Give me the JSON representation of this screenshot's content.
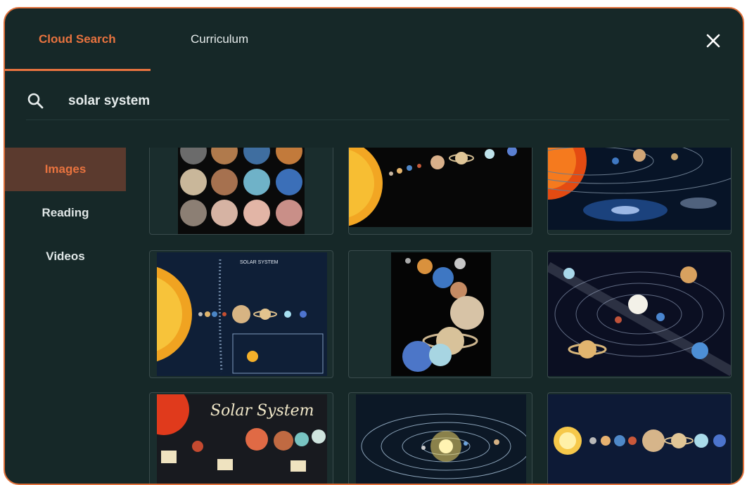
{
  "tabs": [
    {
      "label": "Cloud Search",
      "active": true
    },
    {
      "label": "Curriculum",
      "active": false
    }
  ],
  "search": {
    "value": "solar system"
  },
  "categories": [
    {
      "label": "Images",
      "active": true
    },
    {
      "label": "Reading",
      "active": false
    },
    {
      "label": "Videos",
      "active": false
    }
  ],
  "results": {
    "tile_5_title": "SOLAR SYSTEM",
    "tile_7_title": "Solar System"
  },
  "colors": {
    "accent": "#e8733f",
    "background": "#162828",
    "active_category_bg": "#5b3a2e"
  }
}
